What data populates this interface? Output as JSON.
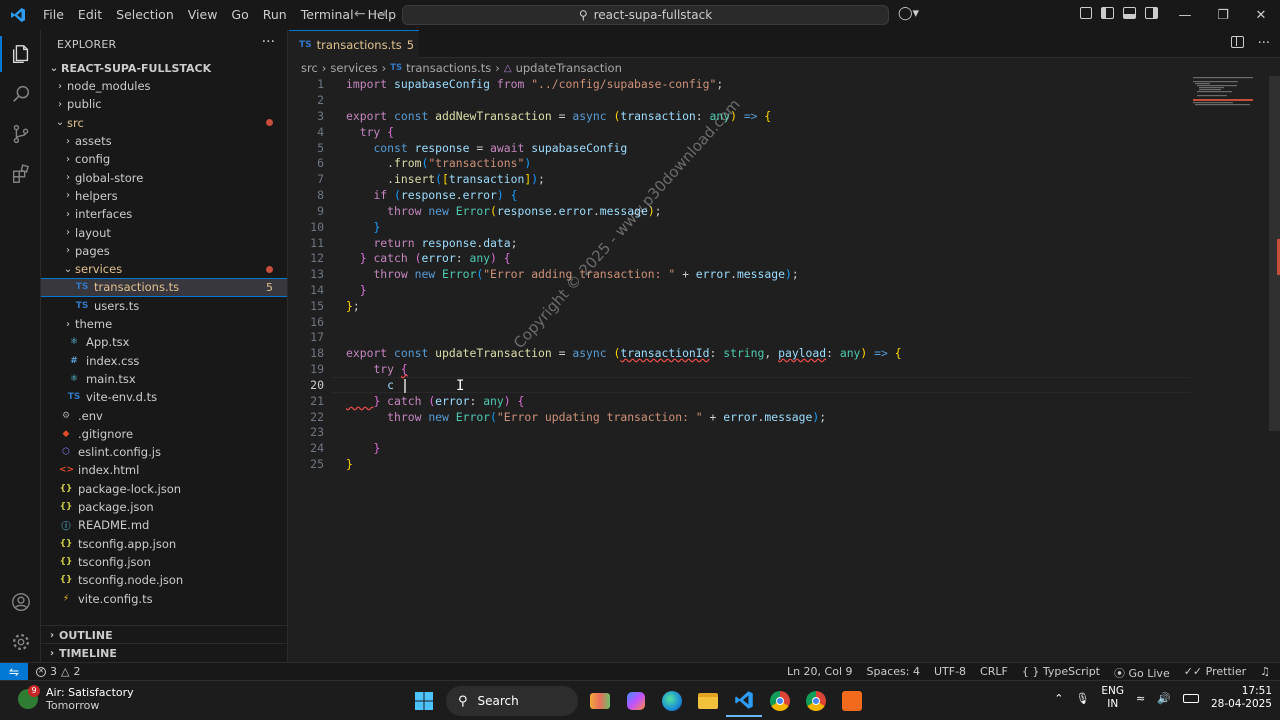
{
  "titlebar": {
    "menu": [
      "File",
      "Edit",
      "Selection",
      "View",
      "Go",
      "Run",
      "Terminal",
      "Help"
    ],
    "command_center": "react-supa-fullstack"
  },
  "explorer": {
    "title": "EXPLORER",
    "project": "REACT-SUPA-FULLSTACK",
    "tree": [
      {
        "label": "node_modules",
        "type": "folder",
        "depth": 1,
        "open": false
      },
      {
        "label": "public",
        "type": "folder",
        "depth": 1,
        "open": false
      },
      {
        "label": "src",
        "type": "folder",
        "depth": 1,
        "open": true,
        "color": "#e2c08d",
        "modified": true
      },
      {
        "label": "assets",
        "type": "folder",
        "depth": 2,
        "open": false
      },
      {
        "label": "config",
        "type": "folder",
        "depth": 2,
        "open": false
      },
      {
        "label": "global-store",
        "type": "folder",
        "depth": 2,
        "open": false
      },
      {
        "label": "helpers",
        "type": "folder",
        "depth": 2,
        "open": false
      },
      {
        "label": "interfaces",
        "type": "folder",
        "depth": 2,
        "open": false
      },
      {
        "label": "layout",
        "type": "folder",
        "depth": 2,
        "open": false
      },
      {
        "label": "pages",
        "type": "folder",
        "depth": 2,
        "open": false
      },
      {
        "label": "services",
        "type": "folder",
        "depth": 2,
        "open": true,
        "color": "#e2c08d",
        "modified": true
      },
      {
        "label": "transactions.ts",
        "type": "ts",
        "depth": 3,
        "selected": true,
        "color": "#e2c08d",
        "badge": "5"
      },
      {
        "label": "users.ts",
        "type": "ts",
        "depth": 3
      },
      {
        "label": "theme",
        "type": "folder",
        "depth": 2,
        "open": false
      },
      {
        "label": "App.tsx",
        "type": "tsx",
        "depth": 2
      },
      {
        "label": "index.css",
        "type": "css",
        "depth": 2
      },
      {
        "label": "main.tsx",
        "type": "tsx",
        "depth": 2
      },
      {
        "label": "vite-env.d.ts",
        "type": "ts",
        "depth": 2
      },
      {
        "label": ".env",
        "type": "env",
        "depth": 1
      },
      {
        "label": ".gitignore",
        "type": "git",
        "depth": 1
      },
      {
        "label": "eslint.config.js",
        "type": "eslint",
        "depth": 1
      },
      {
        "label": "index.html",
        "type": "html",
        "depth": 1
      },
      {
        "label": "package-lock.json",
        "type": "json",
        "depth": 1
      },
      {
        "label": "package.json",
        "type": "json",
        "depth": 1
      },
      {
        "label": "README.md",
        "type": "info",
        "depth": 1
      },
      {
        "label": "tsconfig.app.json",
        "type": "json",
        "depth": 1
      },
      {
        "label": "tsconfig.json",
        "type": "json",
        "depth": 1
      },
      {
        "label": "tsconfig.node.json",
        "type": "json",
        "depth": 1
      },
      {
        "label": "vite.config.ts",
        "type": "vite",
        "depth": 1
      }
    ],
    "outline": "OUTLINE",
    "timeline": "TIMELINE"
  },
  "tab": {
    "prefix": "TS",
    "name": "transactions.ts",
    "problems": "5"
  },
  "breadcrumb": [
    "src",
    "services",
    "transactions.ts",
    "updateTransaction"
  ],
  "editor": {
    "current_line": 20,
    "line_count": 25
  },
  "watermark": "Copyright © 2025 - www.p30download.com",
  "statusbar": {
    "errors": "3",
    "warnings": "2",
    "position": "Ln 20, Col 9",
    "spaces": "Spaces: 4",
    "encoding": "UTF-8",
    "eol": "CRLF",
    "language": "TypeScript",
    "golive": "Go Live",
    "prettier": "Prettier"
  },
  "taskbar": {
    "weather_title": "Air: Satisfactory",
    "weather_sub": "Tomorrow",
    "weather_badge": "9",
    "search": "Search",
    "lang1": "ENG",
    "lang2": "IN",
    "time": "17:51",
    "date": "28-04-2025"
  },
  "colors": {
    "accent": "#0078d4",
    "modified": "#e2c08d",
    "error": "#f14c4c"
  }
}
